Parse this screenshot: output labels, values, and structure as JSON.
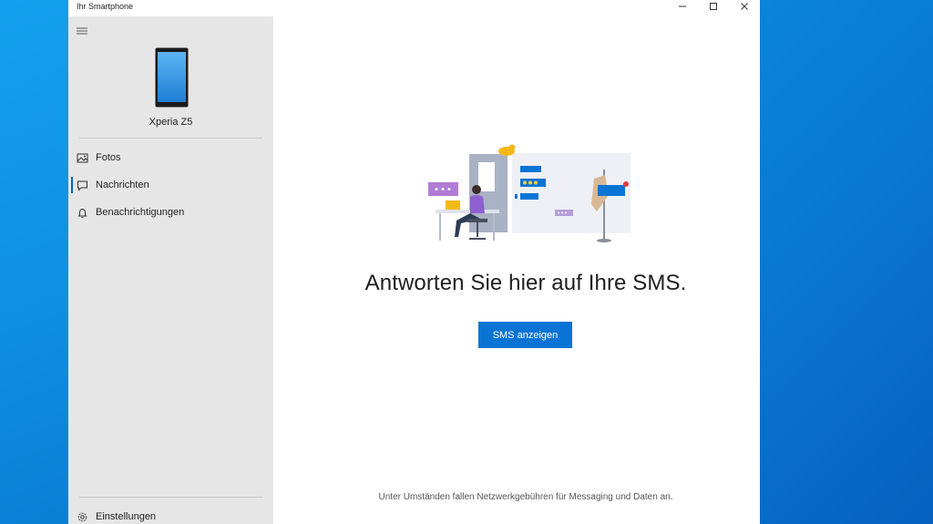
{
  "window": {
    "title": "Ihr Smartphone",
    "accent_color": "#0a74d4"
  },
  "sidebar": {
    "device_name": "Xperia Z5",
    "items": [
      {
        "label": "Fotos",
        "icon": "photos-icon",
        "selected": false
      },
      {
        "label": "Nachrichten",
        "icon": "message-icon",
        "selected": true
      },
      {
        "label": "Benachrichtigungen",
        "icon": "bell-icon",
        "selected": false
      }
    ],
    "settings_label": "Einstellungen"
  },
  "main": {
    "headline": "Antworten Sie hier auf Ihre SMS.",
    "cta_label": "SMS anzeigen",
    "footnote": "Unter Umständen fallen Netzwerkgebühren für Messaging und Daten an."
  }
}
